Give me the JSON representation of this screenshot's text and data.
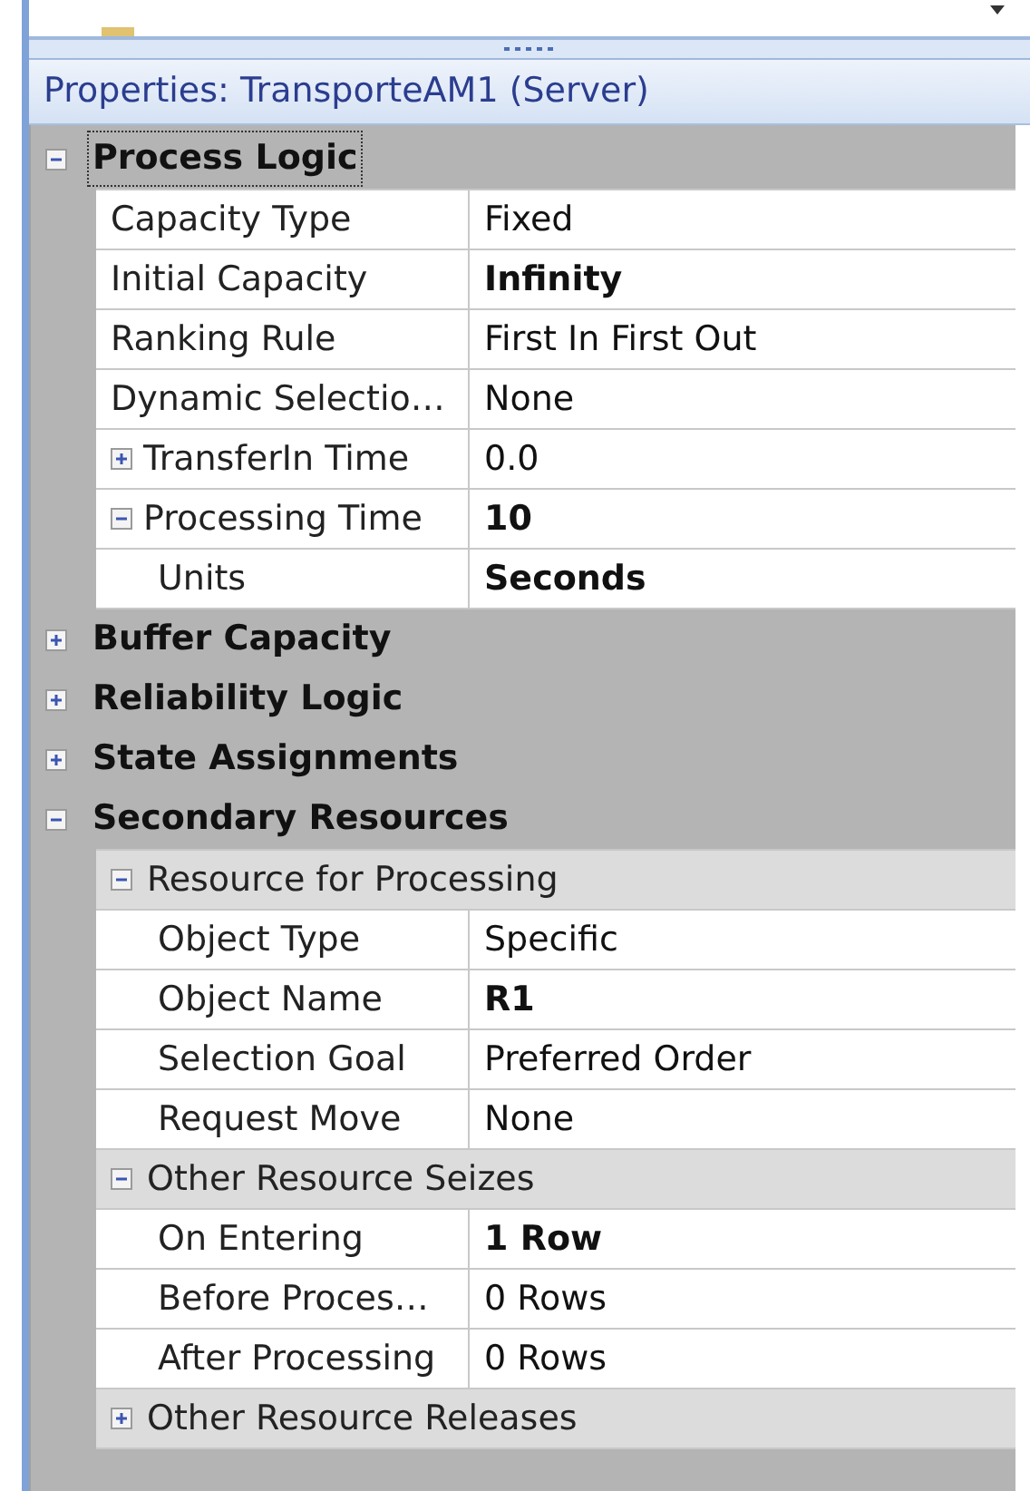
{
  "panel": {
    "title": "Properties: TransporteAM1 (Server)"
  },
  "categories": [
    {
      "name": "Process Logic",
      "expanded": true,
      "selected": true,
      "rows": [
        {
          "kind": "property",
          "name": "Capacity Type",
          "value": "Fixed",
          "modified": false
        },
        {
          "kind": "property",
          "name": "Initial Capacity",
          "value": "Infinity",
          "modified": true
        },
        {
          "kind": "property",
          "name": "Ranking Rule",
          "value": "First In First Out",
          "modified": false
        },
        {
          "kind": "property",
          "name": "Dynamic Selectio…",
          "value": "None",
          "modified": false
        },
        {
          "kind": "property",
          "name": "TransferIn Time",
          "value": "0.0",
          "modified": false,
          "expanded": false
        },
        {
          "kind": "property",
          "name": "Processing Time",
          "value": "10",
          "modified": true,
          "expanded": true,
          "children": [
            {
              "kind": "property",
              "name": "Units",
              "value": "Seconds",
              "modified": true
            }
          ]
        }
      ]
    },
    {
      "name": "Buffer Capacity",
      "expanded": false,
      "selected": false
    },
    {
      "name": "Reliability Logic",
      "expanded": false,
      "selected": false
    },
    {
      "name": "State Assignments",
      "expanded": false,
      "selected": false
    },
    {
      "name": "Secondary Resources",
      "expanded": true,
      "selected": false,
      "rows": [
        {
          "kind": "group",
          "name": "Resource for Processing",
          "expanded": true,
          "children": [
            {
              "kind": "property",
              "name": "Object Type",
              "value": "Specific",
              "modified": false
            },
            {
              "kind": "property",
              "name": "Object Name",
              "value": "R1",
              "modified": true
            },
            {
              "kind": "property",
              "name": "Selection Goal",
              "value": "Preferred Order",
              "modified": false
            },
            {
              "kind": "property",
              "name": "Request Move",
              "value": "None",
              "modified": false
            }
          ]
        },
        {
          "kind": "group",
          "name": "Other Resource Seizes",
          "expanded": true,
          "children": [
            {
              "kind": "property",
              "name": "On Entering",
              "value": "1 Row",
              "modified": true
            },
            {
              "kind": "property",
              "name": "Before Proces…",
              "value": "0 Rows",
              "modified": false
            },
            {
              "kind": "property",
              "name": "After Processing",
              "value": "0 Rows",
              "modified": false
            }
          ]
        },
        {
          "kind": "group",
          "name": "Other Resource Releases",
          "expanded": false
        }
      ]
    }
  ]
}
